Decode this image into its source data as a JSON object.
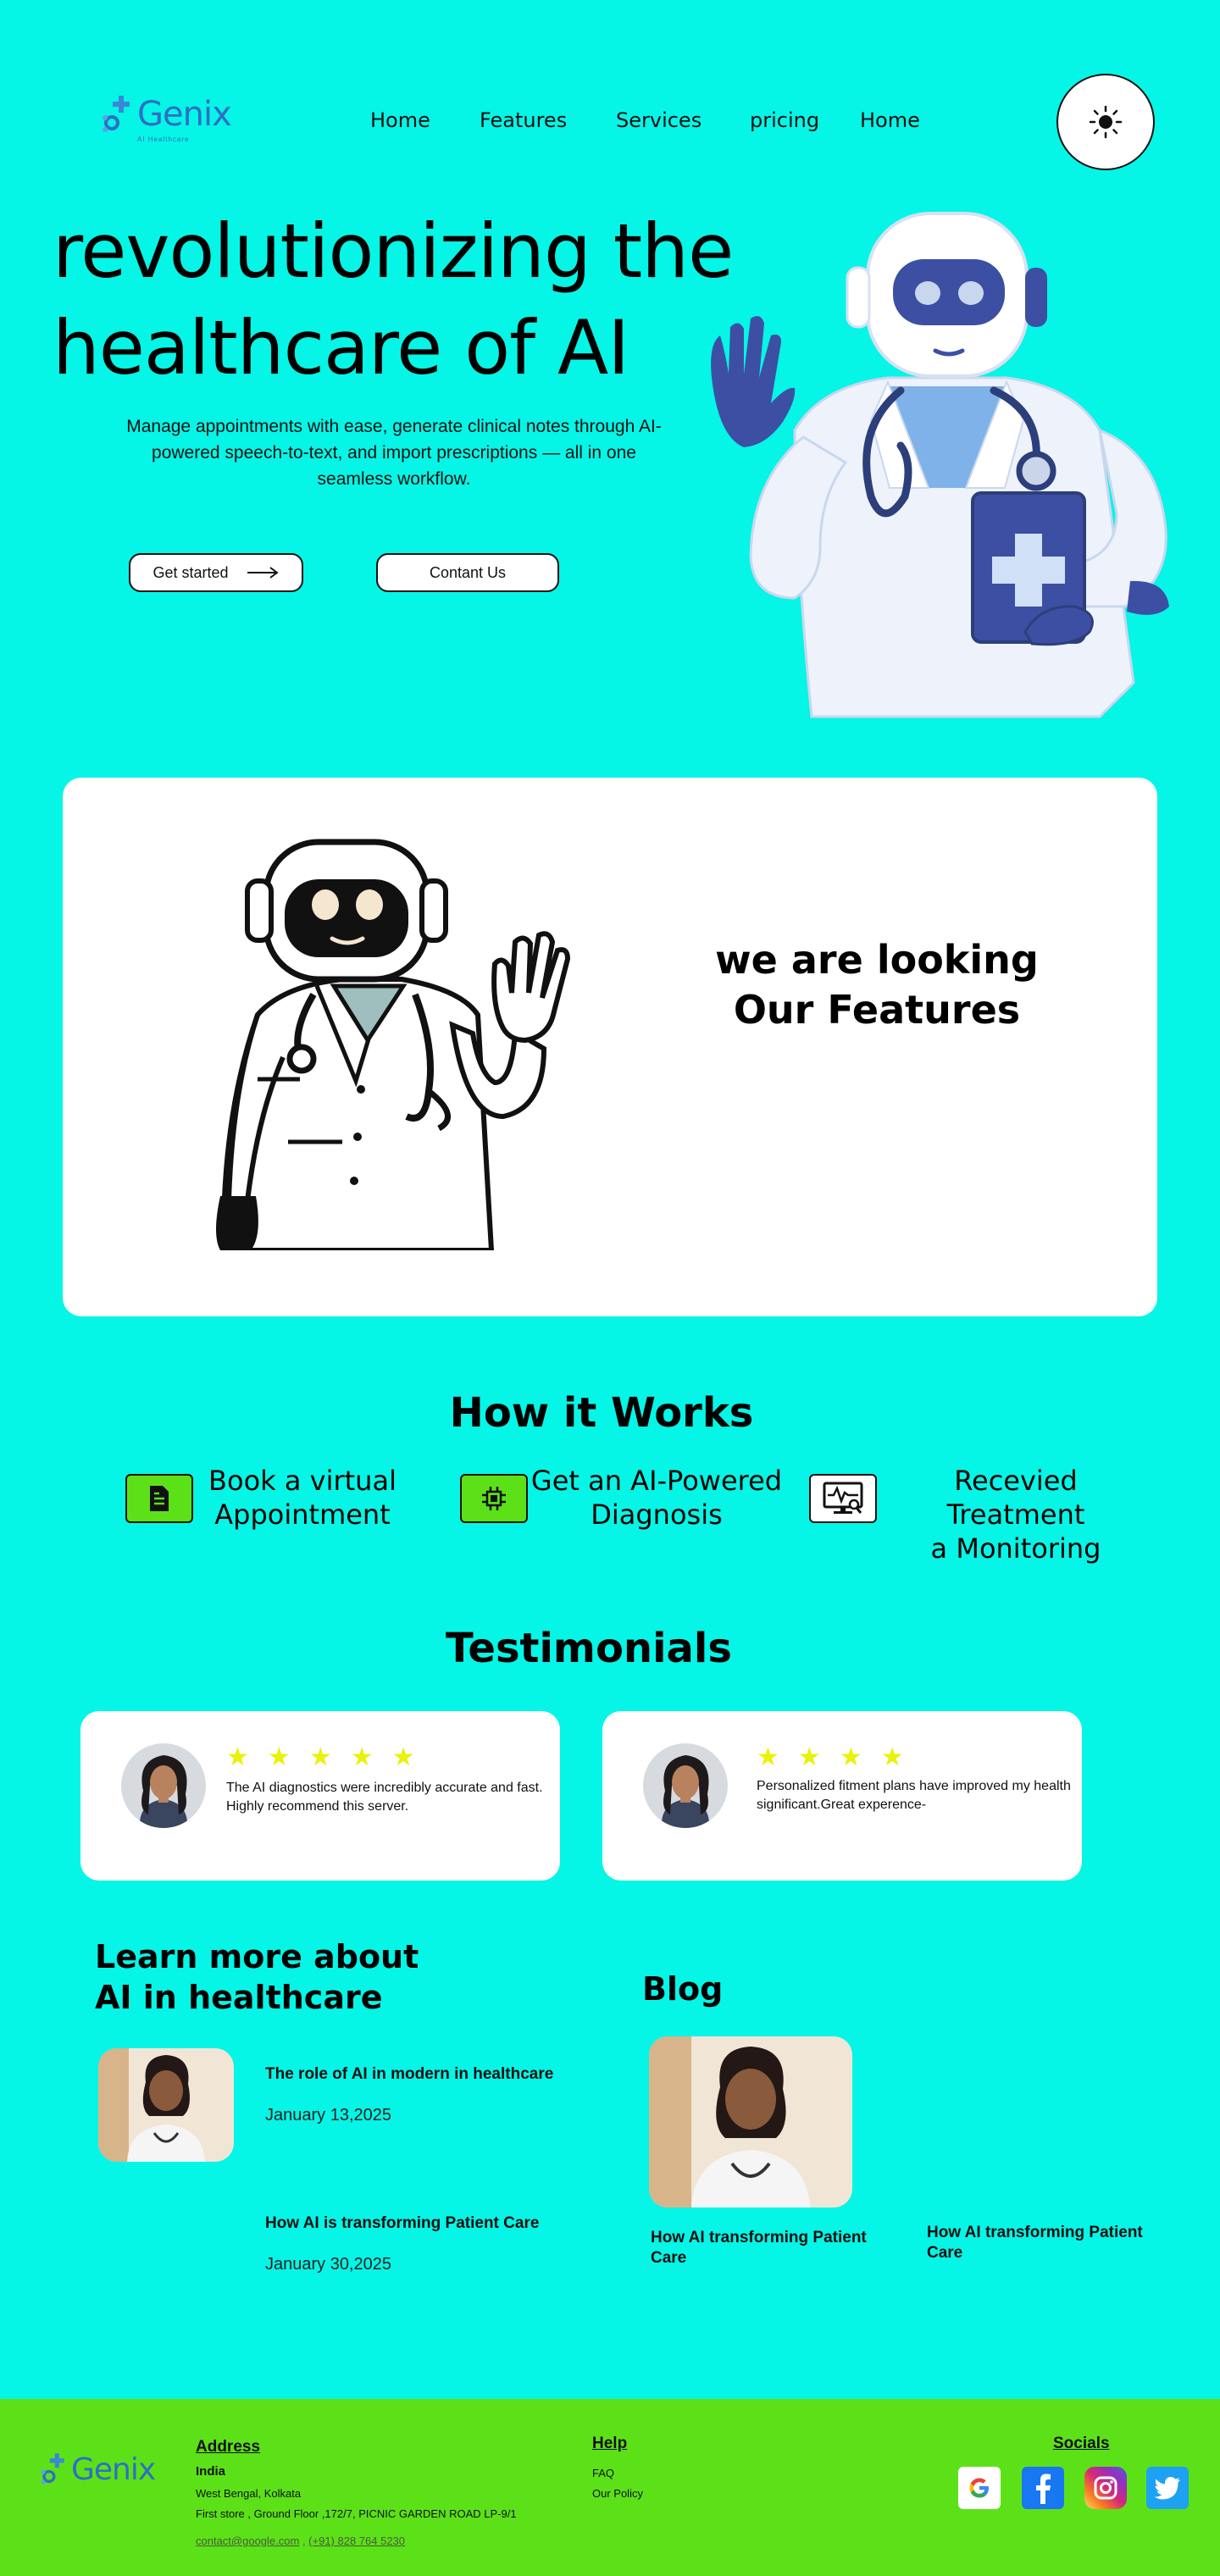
{
  "brand": {
    "name": "Genix",
    "tagline": "AI Healthcare"
  },
  "nav": {
    "items": [
      "Home",
      "Features",
      "Services",
      "pricing",
      "Home"
    ]
  },
  "hero": {
    "title_line1": "revolutionizing the",
    "title_line2": "healthcare of AI",
    "description": "Manage appointments with ease, generate clinical notes through AI-powered speech-to-text, and import prescriptions — all in one seamless workflow.",
    "get_started": "Get started",
    "contact": "Contant Us"
  },
  "features": {
    "line1": "we are looking",
    "line2": "Our Features"
  },
  "how": {
    "title": "How it Works",
    "steps": [
      {
        "line1": "Book a virtual",
        "line2": "Appointment",
        "icon": "document-icon"
      },
      {
        "line1": "Get an AI-Powered",
        "line2": "Diagnosis",
        "icon": "chip-icon"
      },
      {
        "line1": "Recevied Treatment",
        "line2": "a Monitoring",
        "icon": "monitor-icon"
      }
    ]
  },
  "testimonials": {
    "title": "Testimonials",
    "items": [
      {
        "rating": 5,
        "text": "The AI diagnostics were incredibly accurate and fast. Highly recommend this server."
      },
      {
        "rating": 4,
        "text": "Personalized fitment plans have improved my health significant.Great experence-"
      }
    ]
  },
  "learn": {
    "title_line1": "Learn more about",
    "title_line2": "AI in healthcare",
    "articles": [
      {
        "title": "The role of AI in modern in healthcare",
        "date": "January 13,2025"
      },
      {
        "title": "How AI is transforming Patient Care",
        "date": "January 30,2025"
      }
    ]
  },
  "blog": {
    "title": "Blog",
    "items": [
      {
        "caption": "How AI transforming Patient Care"
      },
      {
        "caption": "How AI transforming Patient Care"
      }
    ]
  },
  "footer": {
    "address_heading": "Address",
    "country": "India",
    "city": "West Bengal, Kolkata",
    "street": "First store , Ground Floor ,172/7, PICNIC GARDEN ROAD LP-9/1",
    "email": "contact@google.com",
    "separator": " , ",
    "phone": "(+91) 828 764 5230",
    "help_heading": "Help",
    "help_links": [
      "FAQ",
      "Our Policy"
    ],
    "socials_heading": "Socials",
    "socials": [
      "google-icon",
      "facebook-icon",
      "instagram-icon",
      "twitter-icon"
    ]
  },
  "colors": {
    "background": "#05f5e6",
    "footer": "#5ce118",
    "icon_green": "#5ce118",
    "star": "#e8f20a",
    "robot_blue": "#3d4fa3"
  }
}
